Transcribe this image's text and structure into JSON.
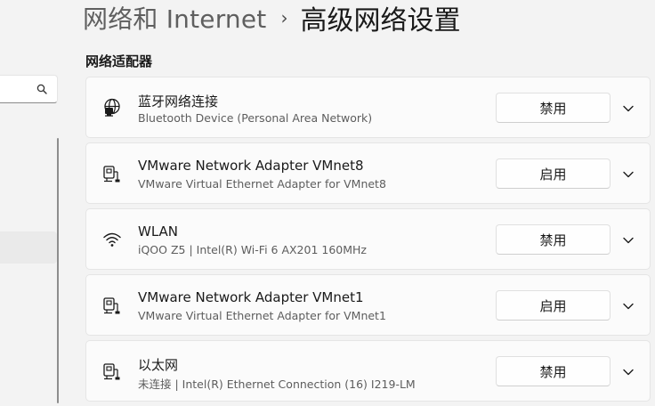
{
  "header": {
    "parent": "网络和 Internet",
    "separator": "›",
    "current": "高级网络设置"
  },
  "section_title": "网络适配器",
  "nav": {
    "search_icon": "search-icon"
  },
  "adapters": [
    {
      "name": "蓝牙网络连接",
      "description": "Bluetooth Device (Personal Area Network)",
      "action": "禁用",
      "icon": "bluetooth-network-icon"
    },
    {
      "name": "VMware Network Adapter VMnet8",
      "description": "VMware Virtual Ethernet Adapter for VMnet8",
      "action": "启用",
      "icon": "ethernet-icon"
    },
    {
      "name": "WLAN",
      "description": "iQOO Z5 | Intel(R) Wi-Fi 6 AX201 160MHz",
      "action": "禁用",
      "icon": "wifi-icon"
    },
    {
      "name": "VMware Network Adapter VMnet1",
      "description": "VMware Virtual Ethernet Adapter for VMnet1",
      "action": "启用",
      "icon": "ethernet-icon"
    },
    {
      "name": "以太网",
      "description": "未连接 | Intel(R) Ethernet Connection (16) I219-LM",
      "action": "禁用",
      "icon": "ethernet-icon"
    }
  ]
}
